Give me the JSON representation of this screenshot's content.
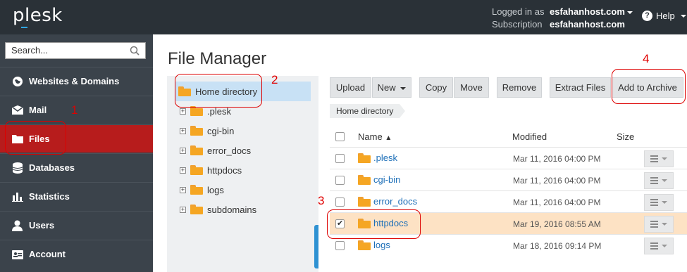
{
  "header": {
    "logo": "plesk",
    "logged_in_label": "Logged in as",
    "logged_in_value": "esfahanhost.com",
    "subscription_label": "Subscription",
    "subscription_value": "esfahanhost.com",
    "help": "Help"
  },
  "sidebar": {
    "search_placeholder": "Search...",
    "items": [
      {
        "label": "Websites & Domains",
        "icon": "globe-icon"
      },
      {
        "label": "Mail",
        "icon": "envelope-icon"
      },
      {
        "label": "Files",
        "icon": "folder-icon",
        "active": true
      },
      {
        "label": "Databases",
        "icon": "database-icon"
      },
      {
        "label": "Statistics",
        "icon": "bar-chart-icon"
      },
      {
        "label": "Users",
        "icon": "user-icon"
      },
      {
        "label": "Account",
        "icon": "id-card-icon"
      }
    ]
  },
  "page_title": "File Manager",
  "tree": {
    "root": "Home directory",
    "children": [
      ".plesk",
      "cgi-bin",
      "error_docs",
      "httpdocs",
      "logs",
      "subdomains"
    ]
  },
  "toolbar": {
    "upload": "Upload",
    "new": "New",
    "copy": "Copy",
    "move": "Move",
    "remove": "Remove",
    "extract": "Extract Files",
    "archive": "Add to Archive"
  },
  "breadcrumb": "Home directory",
  "table": {
    "columns": {
      "name": "Name",
      "modified": "Modified",
      "size": "Size"
    },
    "rows": [
      {
        "name": ".plesk",
        "modified": "Mar 11, 2016 04:00 PM",
        "checked": false
      },
      {
        "name": "cgi-bin",
        "modified": "Mar 11, 2016 04:00 PM",
        "checked": false
      },
      {
        "name": "error_docs",
        "modified": "Mar 11, 2016 04:00 PM",
        "checked": false
      },
      {
        "name": "httpdocs",
        "modified": "Mar 19, 2016 08:55 AM",
        "checked": true
      },
      {
        "name": "logs",
        "modified": "Mar 18, 2016 09:14 PM",
        "checked": false
      }
    ]
  },
  "annotations": [
    "1",
    "2",
    "3",
    "4"
  ],
  "colors": {
    "active_nav": "#b71c1c",
    "annotation": "#e00000",
    "selected_row": "#fde2c4",
    "link": "#1d6fb8"
  }
}
